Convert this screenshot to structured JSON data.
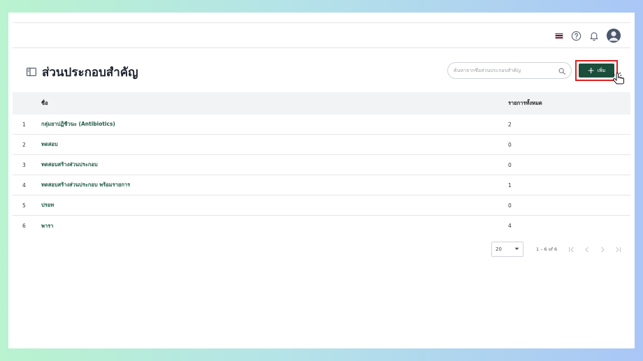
{
  "header": {
    "flag_colors": [
      "#a51931",
      "#f4f5f8",
      "#2d2a4a",
      "#f4f5f8",
      "#a51931"
    ],
    "icons": [
      "thai-flag-icon",
      "help-icon",
      "bell-icon",
      "avatar"
    ]
  },
  "page": {
    "title": "ส่วนประกอบสำคัญ",
    "title_icon": "sidebar-panel-icon"
  },
  "search": {
    "placeholder": "ค้นหาจากชื่อส่วนประกอบสำคัญ",
    "icon": "search-icon"
  },
  "toolbar": {
    "add_label": "เพิ่ม",
    "add_icon": "plus-icon"
  },
  "table": {
    "columns": {
      "name": "ชื่อ",
      "total": "รายการทั้งหมด"
    },
    "rows": [
      {
        "index": "1",
        "name": "กลุ่มยาปฏิชีวนะ (Antibiotics)",
        "total": "2"
      },
      {
        "index": "2",
        "name": "ทดสอบ",
        "total": "0"
      },
      {
        "index": "3",
        "name": "ทดสอบสร้างส่วนประกอบ",
        "total": "0"
      },
      {
        "index": "4",
        "name": "ทดสอบสร้างส่วนประกอบ พร้อมรายการ",
        "total": "1"
      },
      {
        "index": "5",
        "name": "ปรอท",
        "total": "0"
      },
      {
        "index": "6",
        "name": "พารา",
        "total": "4"
      }
    ]
  },
  "pagination": {
    "page_size": "20",
    "range": "1 – 6 of 6"
  },
  "colors": {
    "primary": "#1c4e3c",
    "highlight": "#e0201e",
    "link": "#1d5a47"
  }
}
